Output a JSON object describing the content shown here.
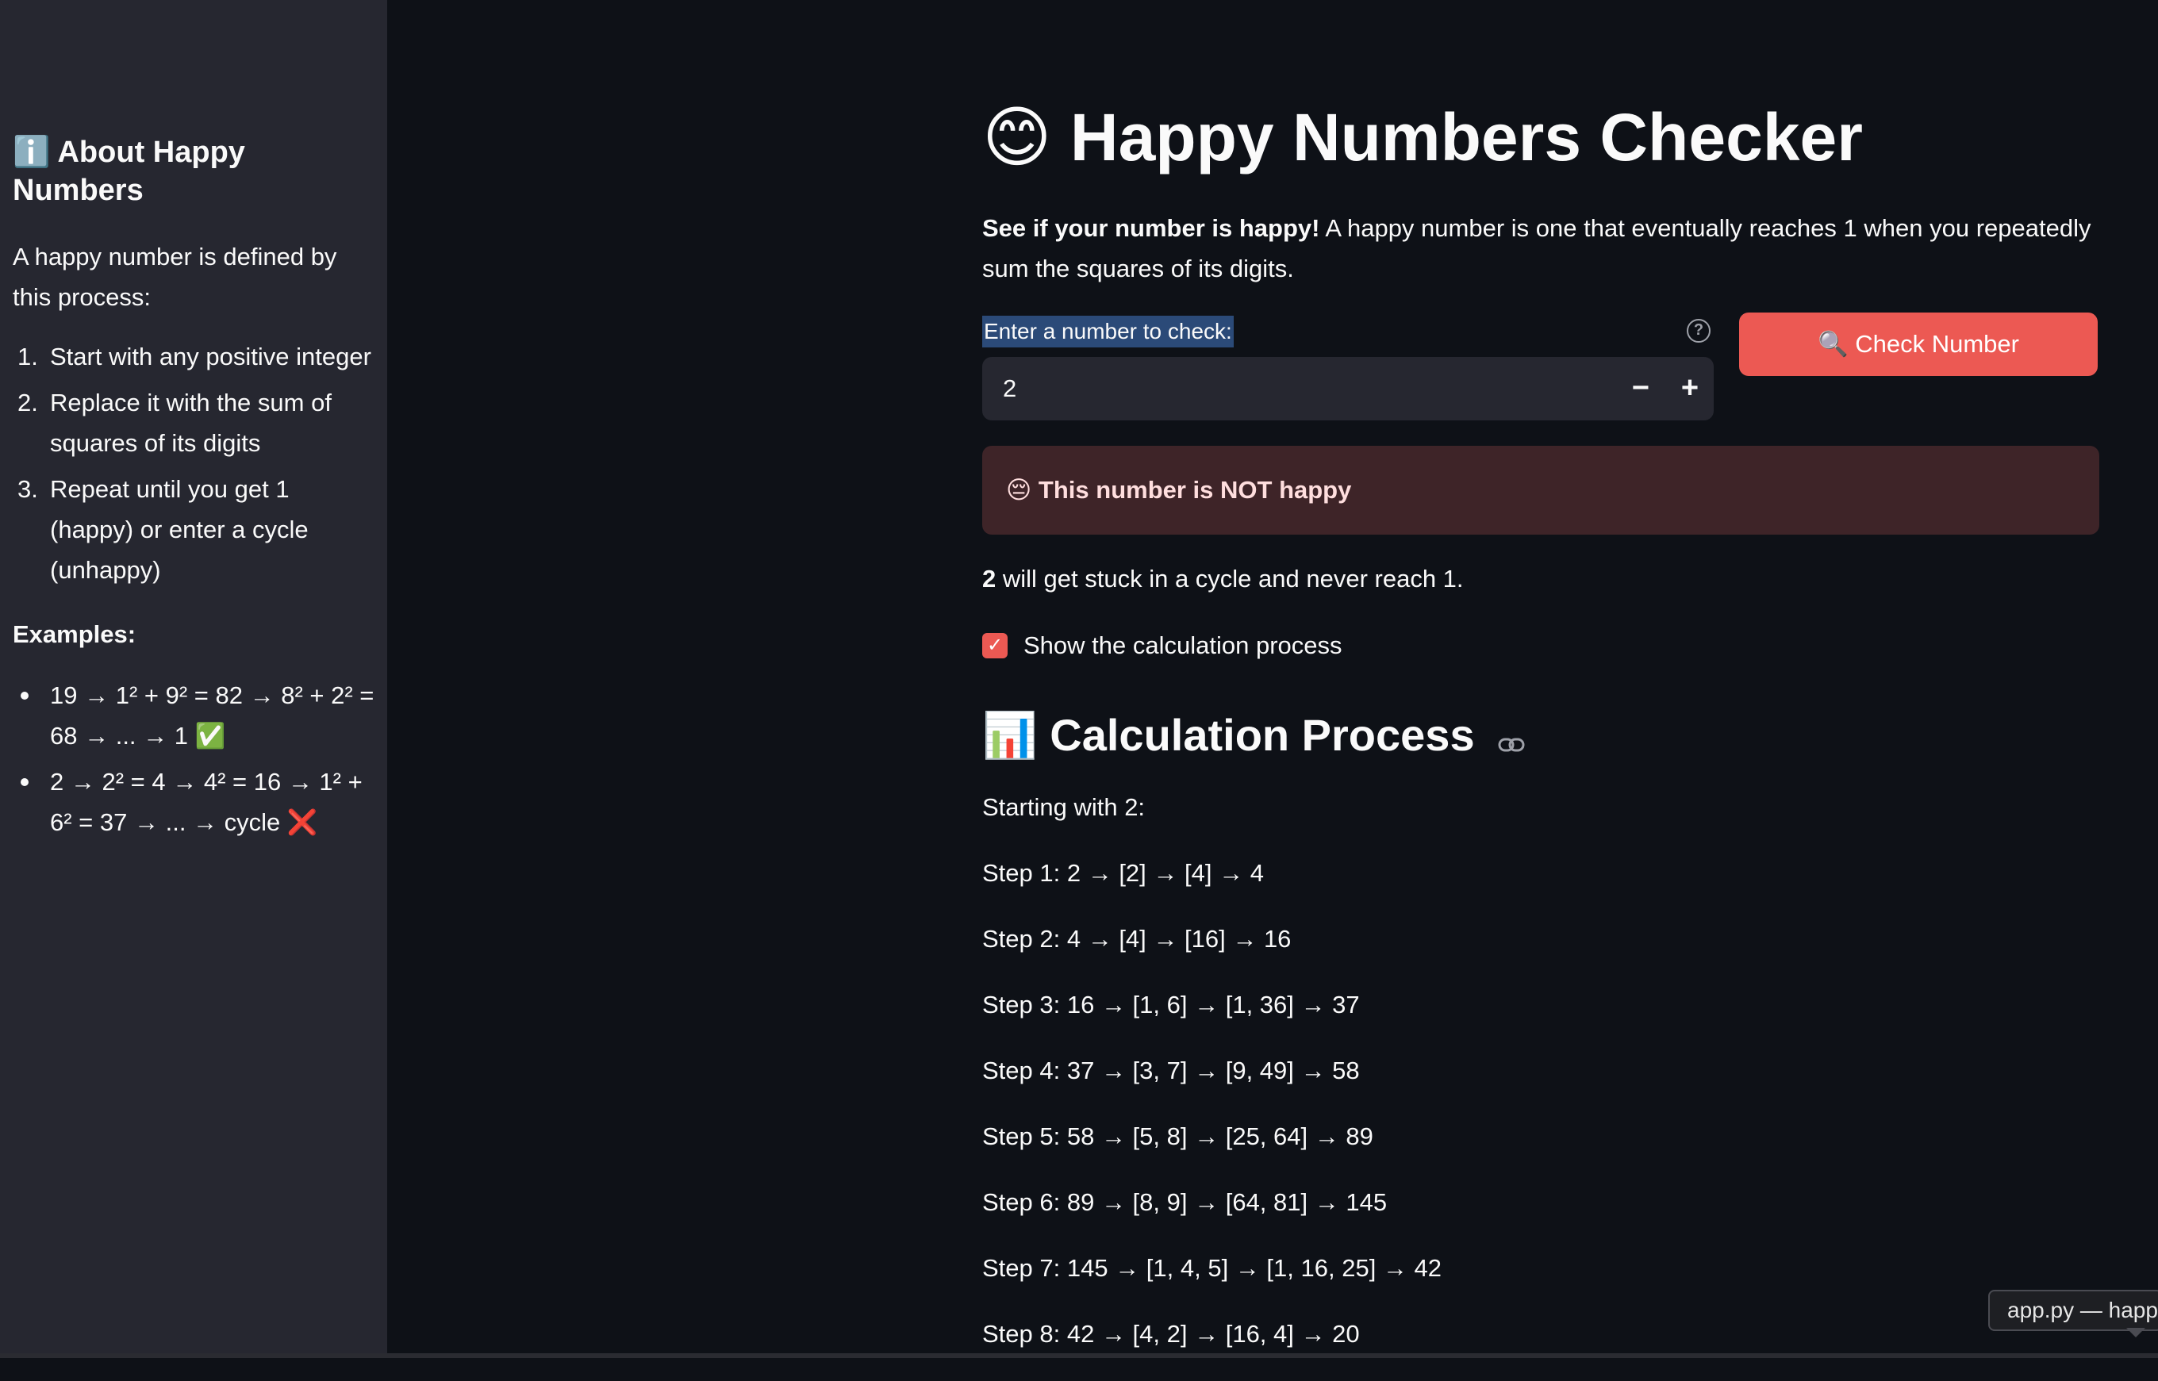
{
  "sidebar": {
    "title_icon": "ℹ️",
    "title": "About Happy Numbers",
    "intro": "A happy number is defined by this process:",
    "steps": [
      {
        "num": "1.",
        "text": "Start with any positive integer"
      },
      {
        "num": "2.",
        "text": "Replace it with the sum of squares of its digits"
      },
      {
        "num": "3.",
        "text": "Repeat until you get 1 (happy) or enter a cycle (unhappy)"
      }
    ],
    "examples_label": "Examples:",
    "examples": [
      "19 → 1² + 9² = 82 → 8² + 2² = 68 → ... → 1 ✅",
      "2 → 2² = 4 → 4² = 16 → 1² + 6² = 37 → ... → cycle ❌"
    ]
  },
  "main": {
    "title": "😊 Happy Numbers Checker",
    "intro_bold": "See if your number is happy!",
    "intro_rest": " A happy number is one that eventually reaches 1 when you repeatedly sum the squares of its digits.",
    "input_label": "Enter a number to check:",
    "input_value": "2",
    "help_icon": "?",
    "minus": "−",
    "plus": "+",
    "check_button": "🔍 Check Number",
    "alert": "😔 This number is NOT happy",
    "stuck_bold": "2",
    "stuck_rest": " will get stuck in a cycle and never reach 1.",
    "show_calc_label": "Show the calculation process",
    "show_calc_checked": true,
    "calc_heading": "📊 Calculation Process",
    "starting": "Starting with 2:",
    "steps": [
      "Step 1: 2 → [2] → [4] → 4",
      "Step 2: 4 → [4] → [16] → 16",
      "Step 3: 16 → [1, 6] → [1, 36] → 37",
      "Step 4: 37 → [3, 7] → [9, 49] → 58",
      "Step 5: 58 → [5, 8] → [25, 64] → 89",
      "Step 6: 89 → [8, 9] → [64, 81] → 145",
      "Step 7: 145 → [1, 4, 5] → [1, 16, 25] → 42",
      "Step 8: 42 → [4, 2] → [16, 4] → 20"
    ]
  },
  "tooltip": "app.py — happ",
  "colors": {
    "background": "#0e1117",
    "sidebar": "#262730",
    "accent": "#ec5953",
    "alert_bg": "#3e2428"
  }
}
